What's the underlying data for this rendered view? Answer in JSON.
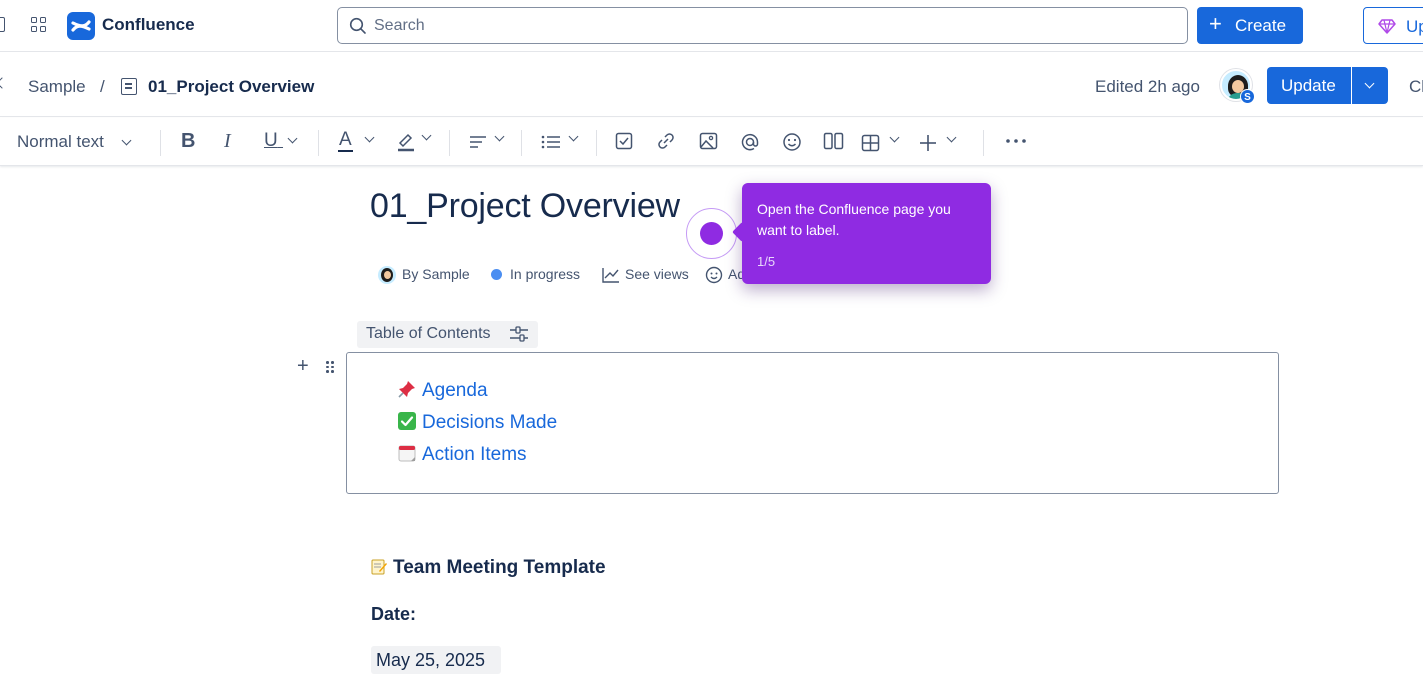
{
  "app": {
    "brand": "Confluence"
  },
  "topbar": {
    "search_placeholder": "Search",
    "create_label": "Create",
    "upgrade_label": "Upgrade"
  },
  "breadcrumb": {
    "space": "Sample",
    "separator": "/",
    "page": "01_Project Overview"
  },
  "pagebar": {
    "edited": "Edited 2h ago",
    "avatar_initial": "S",
    "update_label": "Update",
    "close_label": "Close"
  },
  "toolbar": {
    "text_style": "Normal text",
    "bold": "B",
    "italic": "I",
    "underline": "U",
    "text_color": "A"
  },
  "page": {
    "title": "01_Project Overview",
    "meta": {
      "author": "By Sample",
      "status": "In progress",
      "views": "See views",
      "add": "Add"
    },
    "toc": {
      "label": "Table of Contents",
      "items": [
        {
          "icon": "pushpin-icon",
          "label": "Agenda"
        },
        {
          "icon": "check-mark-button-icon",
          "label": "Decisions Made"
        },
        {
          "icon": "calendar-icon",
          "label": "Action Items"
        }
      ]
    },
    "section_heading": "Team Meeting Template",
    "date_label": "Date:",
    "date_value": "May 25, 2025"
  },
  "guide": {
    "message": "Open the Confluence page you want to label.",
    "step": "1/5"
  },
  "colors": {
    "accent": "#1868db",
    "guide": "#8f2be2",
    "text": "#172b4d",
    "subtle_text": "#44546f"
  }
}
